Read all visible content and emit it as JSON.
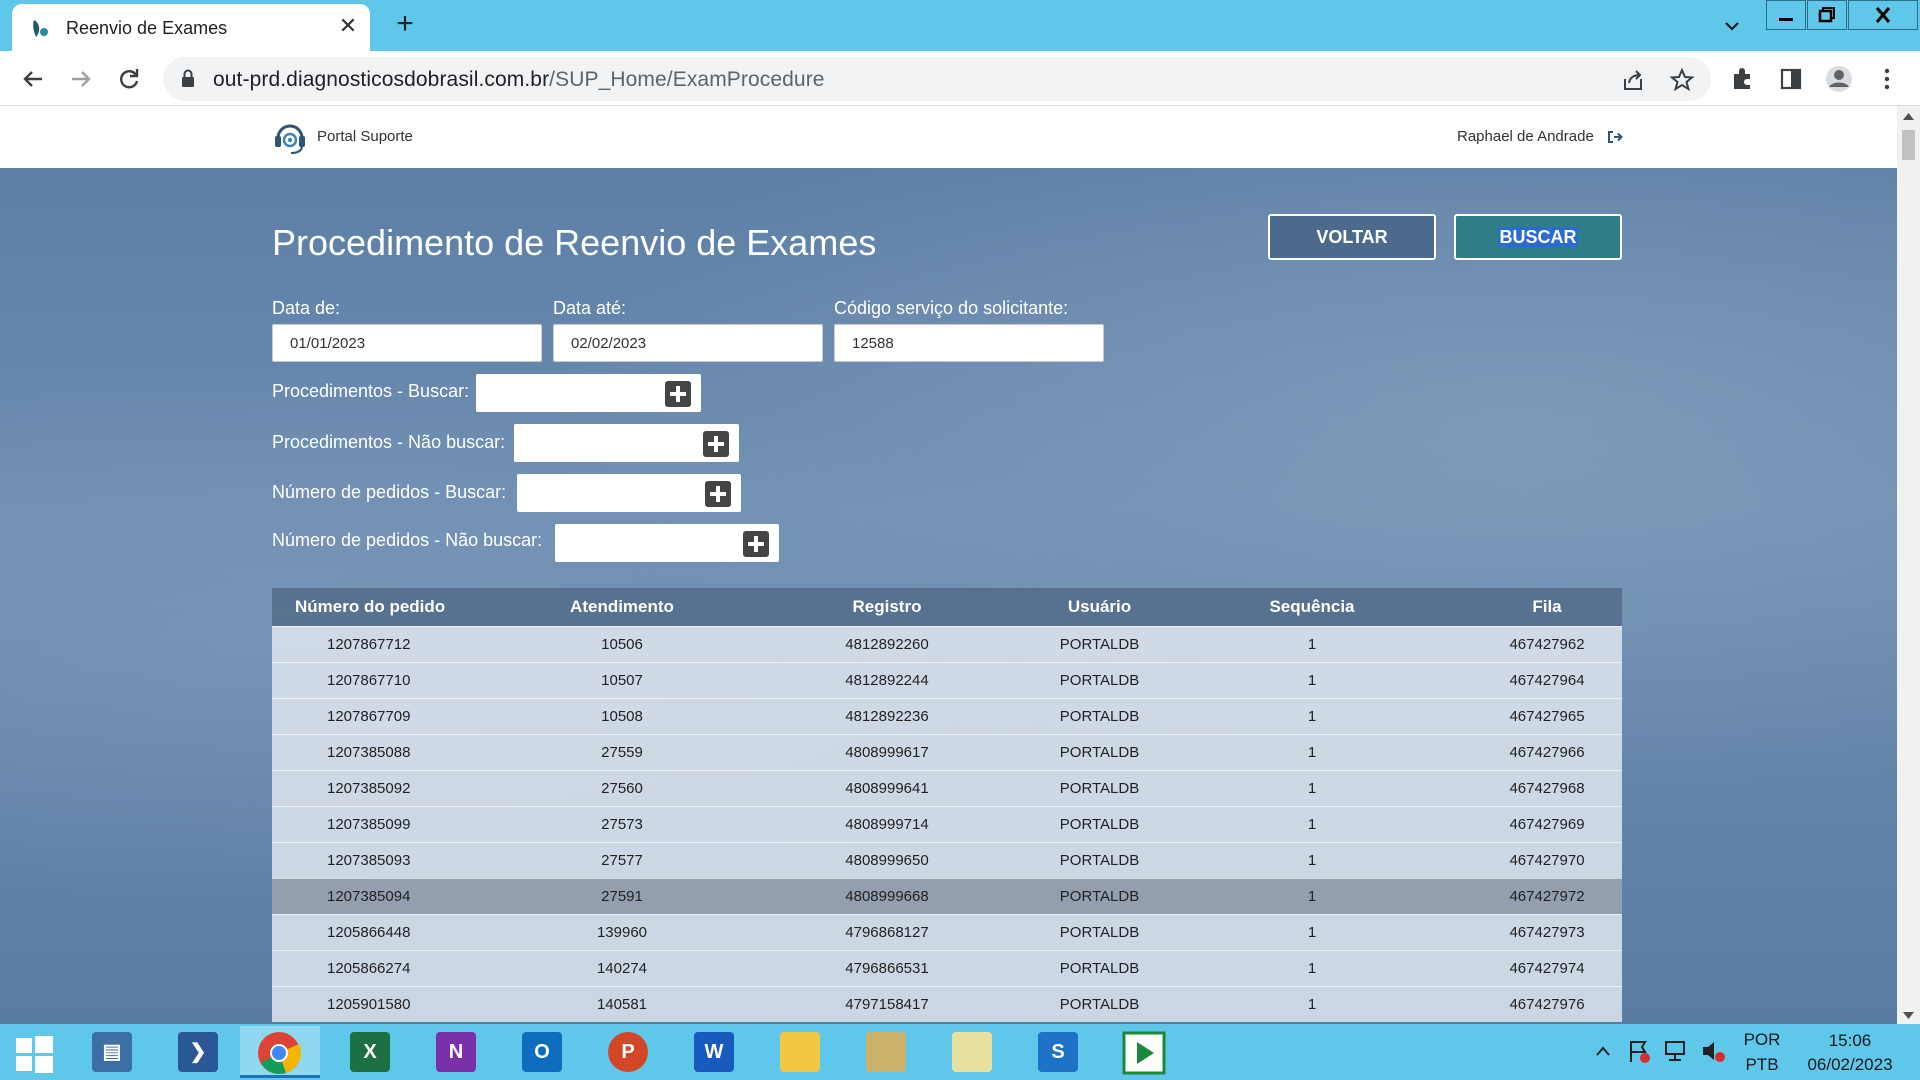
{
  "browser": {
    "tab_title": "Reenvio de Exames",
    "url_host": "out-prd.diagnosticosdobrasil.com.br",
    "url_path": "/SUP_Home/ExamProcedure"
  },
  "site": {
    "logo_text": "Portal Suporte",
    "user_name": "Raphael de Andrade"
  },
  "page": {
    "title": "Procedimento de Reenvio de Exames",
    "voltar_label": "VOLTAR",
    "buscar_label": "BUSCAR"
  },
  "filters": {
    "data_de_label": "Data de:",
    "data_de_value": "01/01/2023",
    "data_ate_label": "Data até:",
    "data_ate_value": "02/02/2023",
    "codigo_label": "Código serviço do solicitante:",
    "codigo_value": "12588",
    "proc_buscar_label": "Procedimentos - Buscar:",
    "proc_nao_buscar_label": "Procedimentos - Não buscar:",
    "ped_buscar_label": "Número de pedidos - Buscar:",
    "ped_nao_buscar_label": "Número de pedidos - Não buscar:"
  },
  "table": {
    "headers": [
      "Número do pedido",
      "Atendimento",
      "Registro",
      "Usuário",
      "Sequência",
      "Fila"
    ],
    "rows": [
      [
        "1207867712",
        "10506",
        "4812892260",
        "PORTALDB",
        "1",
        "467427962"
      ],
      [
        "1207867710",
        "10507",
        "4812892244",
        "PORTALDB",
        "1",
        "467427964"
      ],
      [
        "1207867709",
        "10508",
        "4812892236",
        "PORTALDB",
        "1",
        "467427965"
      ],
      [
        "1207385088",
        "27559",
        "4808999617",
        "PORTALDB",
        "1",
        "467427966"
      ],
      [
        "1207385092",
        "27560",
        "4808999641",
        "PORTALDB",
        "1",
        "467427968"
      ],
      [
        "1207385099",
        "27573",
        "4808999714",
        "PORTALDB",
        "1",
        "467427969"
      ],
      [
        "1207385093",
        "27577",
        "4808999650",
        "PORTALDB",
        "1",
        "467427970"
      ],
      [
        "1207385094",
        "27591",
        "4808999668",
        "PORTALDB",
        "1",
        "467427972"
      ],
      [
        "1205866448",
        "139960",
        "4796868127",
        "PORTALDB",
        "1",
        "467427973"
      ],
      [
        "1205866274",
        "140274",
        "4796866531",
        "PORTALDB",
        "1",
        "467427974"
      ],
      [
        "1205901580",
        "140581",
        "4797158417",
        "PORTALDB",
        "1",
        "467427976"
      ]
    ]
  },
  "taskbar": {
    "lang_top": "POR",
    "lang_bottom": "PTB",
    "time": "15:06",
    "date": "06/02/2023",
    "apps": [
      "start-icon",
      "file-server-icon",
      "powershell-icon",
      "chrome-icon",
      "excel-icon",
      "onenote-icon",
      "outlook-icon",
      "powerpoint-icon",
      "word-icon",
      "file-explorer-icon",
      "notepad-stack-icon",
      "notes-icon",
      "s-app-icon",
      "play-app-icon"
    ]
  },
  "colors": {
    "tabbar": "#5fc7ea",
    "content_bg": "#5d7fa6",
    "buscar_bg": "#2f7e85"
  }
}
